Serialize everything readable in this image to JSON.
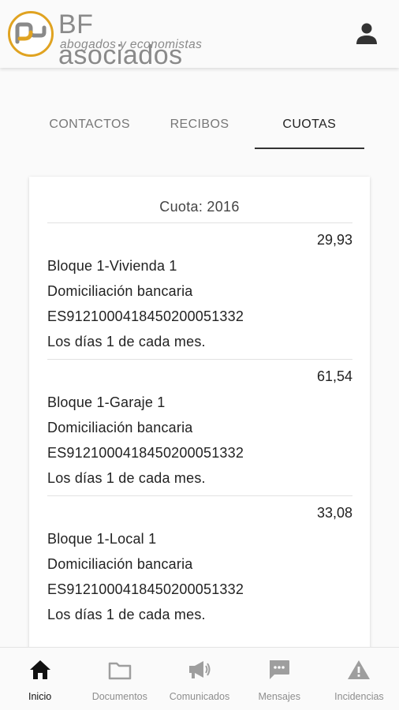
{
  "header": {
    "brand_name": "BF asociados",
    "brand_subtitle": "abogados y economistas"
  },
  "tabs": [
    {
      "label": "CONTACTOS",
      "active": false
    },
    {
      "label": "RECIBOS",
      "active": false
    },
    {
      "label": "CUOTAS",
      "active": true
    }
  ],
  "card": {
    "title": "Cuota: 2016",
    "quotas": [
      {
        "amount": "29,93",
        "unit": "Bloque 1-Vivienda 1",
        "payment_method": "Domiciliación bancaria",
        "iban": "ES9121000418450200051332",
        "schedule": "Los días 1 de cada mes."
      },
      {
        "amount": "61,54",
        "unit": "Bloque 1-Garaje 1",
        "payment_method": "Domiciliación bancaria",
        "iban": "ES9121000418450200051332",
        "schedule": "Los días 1 de cada mes."
      },
      {
        "amount": "33,08",
        "unit": "Bloque 1-Local 1",
        "payment_method": "Domiciliación bancaria",
        "iban": "ES9121000418450200051332",
        "schedule": "Los días 1 de cada mes."
      }
    ]
  },
  "bottom_nav": [
    {
      "label": "Inicio",
      "icon": "home-icon",
      "active": true
    },
    {
      "label": "Documentos",
      "icon": "folder-icon",
      "active": false
    },
    {
      "label": "Comunicados",
      "icon": "megaphone-icon",
      "active": false
    },
    {
      "label": "Mensajes",
      "icon": "chat-icon",
      "active": false
    },
    {
      "label": "Incidencias",
      "icon": "warning-icon",
      "active": false
    }
  ],
  "colors": {
    "logo_accent": "#e0a321",
    "brand_text": "#8a8a8a",
    "active_text": "#222222",
    "inactive_text": "#8e8e8e"
  }
}
